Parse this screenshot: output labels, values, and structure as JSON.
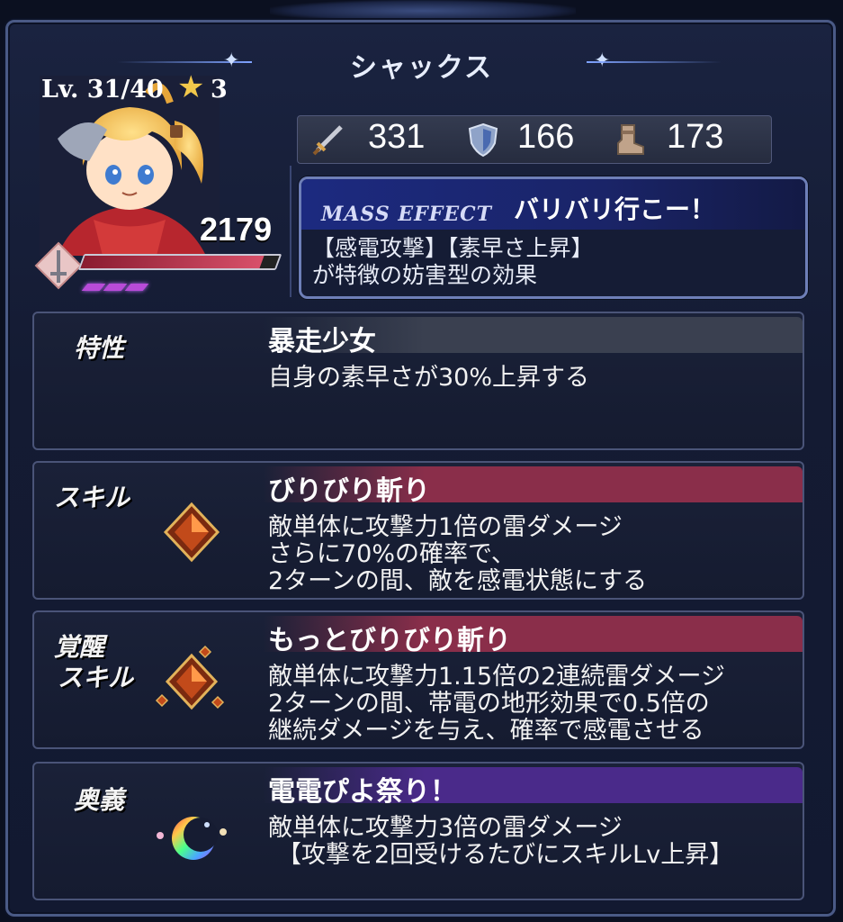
{
  "header": {
    "character_name": "シャックス"
  },
  "character": {
    "level_text": "Lv. 31/40",
    "stars": "3",
    "hp_value": "2179",
    "hp_fraction": 0.92,
    "skill_charges": 3
  },
  "stats": {
    "attack": "331",
    "defense": "166",
    "speed": "173"
  },
  "mass_effect": {
    "label": "MASS EFFECT",
    "name": "バリバリ行こー！",
    "description_line1": "【感電攻撃】【素早さ上昇】",
    "description_line2": "が特徴の妨害型の効果"
  },
  "trait": {
    "label": "特性",
    "name": "暴走少女",
    "desc_lines": [
      "自身の素早さが30%上昇する"
    ]
  },
  "skill": {
    "label": "スキル",
    "name": "びりびり斬り",
    "desc_lines": [
      "敵単体に攻撃力1倍の雷ダメージ",
      "さらに70%の確率で、",
      "2ターンの間、敵を感電状態にする"
    ]
  },
  "awakened_skill": {
    "label_line1": "覚醒",
    "label_line2": "スキル",
    "name": "もっとびりびり斬り",
    "desc_lines": [
      "敵単体に攻撃力1.15倍の2連続雷ダメージ",
      "2ターンの間、帯電の地形効果で0.5倍の",
      "継続ダメージを与え、確率で感電させる"
    ]
  },
  "ultimate": {
    "label": "奥義",
    "name": "電電ぴよ祭り！",
    "desc_lines": [
      "敵単体に攻撃力3倍の雷ダメージ",
      "【攻撃を2回受けるたびにスキルLv上昇】"
    ]
  },
  "colors": {
    "skill_header": "#8a2e4a",
    "awakened_header": "#8a2e4a",
    "ultimate_header": "#4a2a8a",
    "trait_header": "#3a4050",
    "star": "#f2c84b"
  }
}
